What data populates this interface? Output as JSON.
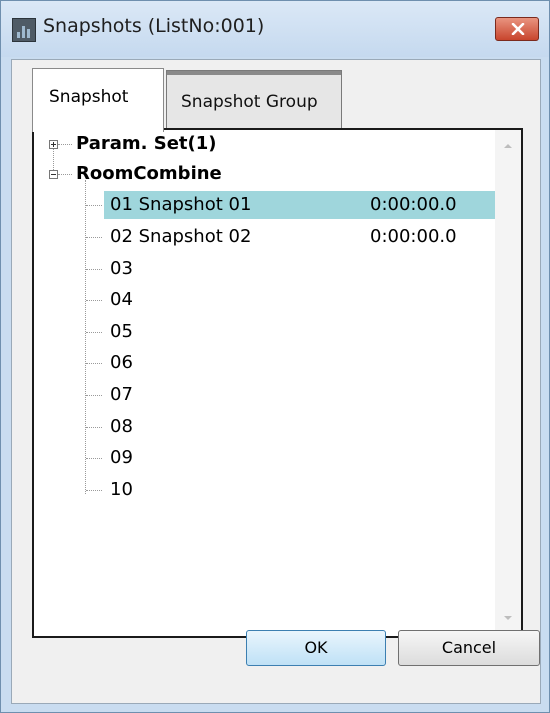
{
  "window": {
    "title": "Snapshots (ListNo:001)"
  },
  "tabs": [
    {
      "label": "Snapshot",
      "active": true
    },
    {
      "label": "Snapshot Group",
      "active": false
    }
  ],
  "tree": {
    "groups": [
      {
        "label": "Param. Set(1)",
        "expanded": false
      },
      {
        "label": "RoomCombine",
        "expanded": true
      }
    ],
    "snapshots": [
      {
        "name": "01 Snapshot 01",
        "time": "0:00:00.0",
        "selected": true
      },
      {
        "name": "02 Snapshot 02",
        "time": "0:00:00.0",
        "selected": false
      },
      {
        "name": "03",
        "time": "",
        "selected": false
      },
      {
        "name": "04",
        "time": "",
        "selected": false
      },
      {
        "name": "05",
        "time": "",
        "selected": false
      },
      {
        "name": "06",
        "time": "",
        "selected": false
      },
      {
        "name": "07",
        "time": "",
        "selected": false
      },
      {
        "name": "08",
        "time": "",
        "selected": false
      },
      {
        "name": "09",
        "time": "",
        "selected": false
      },
      {
        "name": "10",
        "time": "",
        "selected": false
      }
    ]
  },
  "buttons": {
    "ok_label": "OK",
    "cancel_label": "Cancel"
  },
  "icons": {
    "app": "app-icon",
    "close": "close-icon",
    "scroll_up": "scroll-up-icon",
    "scroll_down": "scroll-down-icon"
  },
  "colors": {
    "selection": "#9fd6dc",
    "close_button": "#c8452d",
    "title_bar": "#c5d9ef"
  }
}
